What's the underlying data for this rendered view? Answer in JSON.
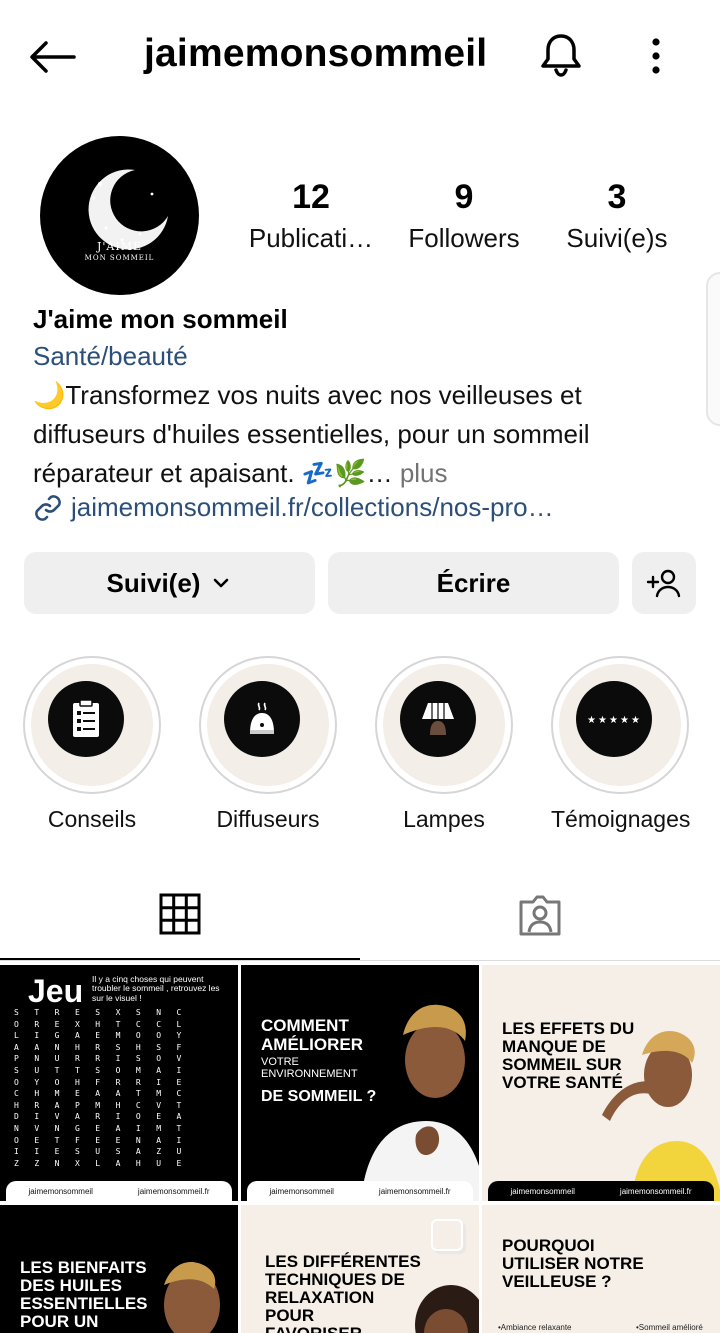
{
  "header": {
    "username": "jaimemonsommeil",
    "back_icon": "arrow-left-icon",
    "bell_icon": "bell-icon",
    "more_icon": "more-vertical-icon"
  },
  "profile": {
    "avatar_text_line1": "J'AIME",
    "avatar_text_line2": "MON SOMMEIL",
    "stats": {
      "posts_count": "12",
      "posts_label": "Publicati…",
      "followers_count": "9",
      "followers_label": "Followers",
      "following_count": "3",
      "following_label": "Suivi(e)s"
    },
    "name": "J'aime mon sommeil",
    "category": "Santé/beauté",
    "bio_line1": "🌙Transformez vos nuits avec nos veilleuses et",
    "bio_line2": "diffuseurs d'huiles essentielles, pour un sommeil",
    "bio_line3": "réparateur et apaisant. 💤🌿…",
    "bio_more": " plus",
    "link": "jaimemonsommeil.fr/collections/nos-pro…"
  },
  "actions": {
    "follow_label": "Suivi(e)",
    "message_label": "Écrire"
  },
  "highlights": [
    {
      "label": "Conseils",
      "icon": "clipboard-checklist-icon"
    },
    {
      "label": "Diffuseurs",
      "icon": "diffuser-icon"
    },
    {
      "label": "Lampes",
      "icon": "lamp-icon"
    },
    {
      "label": "Témoignages",
      "icon": "stars-rating-icon"
    }
  ],
  "tabs": {
    "grid_icon": "grid-icon",
    "tagged_icon": "tagged-person-icon"
  },
  "posts": [
    {
      "title": "Jeu",
      "subtitle": "Il y a cinq choses qui peuvent troubler le sommeil , retrouvez les sur le visuel !",
      "handle": "jaimemonsommeil",
      "site": "jaimemonsommeil.fr"
    },
    {
      "title_line1": "COMMENT",
      "title_line2": "AMÉLIORER",
      "title_line3": "VOTRE",
      "title_line4": "ENVIRONNEMENT",
      "title_line5": "DE SOMMEIL ?",
      "handle": "jaimemonsommeil",
      "site": "jaimemonsommeil.fr"
    },
    {
      "title_line1": "LES EFFETS DU",
      "title_line2": "MANQUE DE",
      "title_line3": "SOMMEIL SUR",
      "title_line4": "VOTRE SANTÉ",
      "handle": "jaimemonsommeil",
      "site": "jaimemonsommeil.fr"
    },
    {
      "title_line1": "LES BIENFAITS",
      "title_line2": "DES HUILES",
      "title_line3": "ESSENTIELLES",
      "title_line4": "POUR UN"
    },
    {
      "title_line1": "LES DIFFÉRENTES",
      "title_line2": "TECHNIQUES DE",
      "title_line3": "RELAXATION",
      "title_line4": "POUR",
      "title_line5": "FAVORISER"
    },
    {
      "title_line1": "POURQUOI",
      "title_line2": "UTILISER NOTRE",
      "title_line3": "VEILLEUSE ?",
      "bullet1": "•Ambiance relaxante",
      "bullet2": "•Sommeil amélioré"
    }
  ]
}
